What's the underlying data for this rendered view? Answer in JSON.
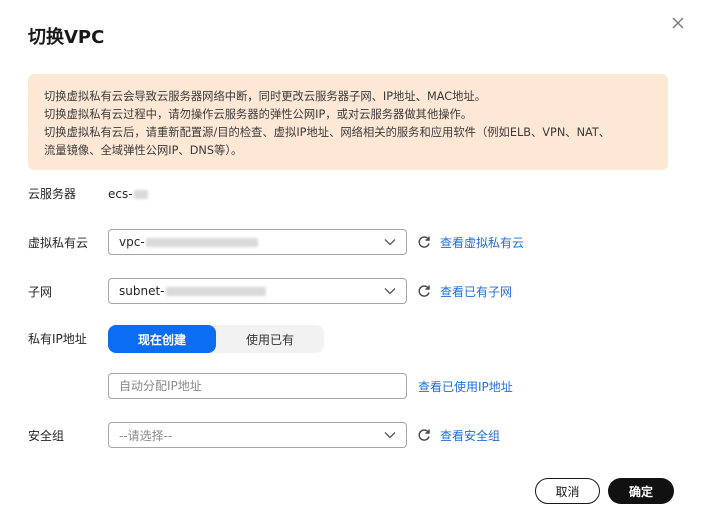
{
  "dialog": {
    "title": "切换VPC",
    "close_icon": "close-icon"
  },
  "warning": {
    "lines": [
      "切换虚拟私有云会导致云服务器网络中断，同时更改云服务器子网、IP地址、MAC地址。",
      "切换虚拟私有云过程中，请勿操作云服务器的弹性公网IP，或对云服务器做其他操作。",
      "切换虚拟私有云后，请重新配置源/目的检查、虚拟IP地址、网络相关的服务和应用软件（例如ELB、VPN、NAT、",
      "流量镜像、全域弹性公网IP、DNS等）。"
    ]
  },
  "form": {
    "server": {
      "label": "云服务器",
      "value": "ecs-"
    },
    "vpc": {
      "label": "虚拟私有云",
      "value": "vpc-",
      "link": "查看虚拟私有云"
    },
    "subnet": {
      "label": "子网",
      "value": "subnet-",
      "link": "查看已有子网"
    },
    "private_ip": {
      "label": "私有IP地址",
      "options": [
        "现在创建",
        "使用已有"
      ],
      "selected": "现在创建",
      "placeholder": "自动分配IP地址",
      "link": "查看已使用IP地址"
    },
    "security_group": {
      "label": "安全组",
      "placeholder": "--请选择--",
      "link": "查看安全组"
    }
  },
  "footer": {
    "cancel_label": "取消",
    "ok_label": "确定"
  },
  "colors": {
    "accent": "#0b6ef2",
    "link": "#1e6fd9",
    "warning_bg": "#fde8d6",
    "primary_button": "#111111"
  }
}
